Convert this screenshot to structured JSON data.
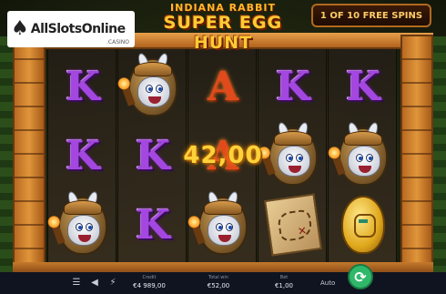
{
  "logo": {
    "brand": "AllSlotsOnline",
    "suffix": ".CASINO"
  },
  "game": {
    "title_top": "INDIANA RABBIT",
    "title_main": "SUPER EGG HUNT"
  },
  "free_spins": {
    "label": "1 OF 10 FREE SPINS",
    "current": 1,
    "total": 10
  },
  "win": {
    "amount": "42,00"
  },
  "reels": [
    [
      "K",
      "K",
      "rabbit"
    ],
    [
      "rabbit",
      "K",
      "K"
    ],
    [
      "A",
      "A",
      "rabbit"
    ],
    [
      "K",
      "rabbit",
      "map"
    ],
    [
      "K",
      "rabbit",
      "golden-egg"
    ]
  ],
  "symbols": {
    "k_letter": "K",
    "a_letter": "A"
  },
  "bottom_bar": {
    "credit_label": "Credit",
    "credit_value": "€4 989,00",
    "total_win_label": "Total win",
    "total_win_value": "€52,00",
    "bet_label": "Bet",
    "bet_value": "€1,00",
    "auto_label": "Auto",
    "menu_icon": "menu-icon",
    "sound_icon": "speaker-icon",
    "turbo_icon": "lightning-icon",
    "spin_icon": "refresh-icon"
  },
  "colors": {
    "k_symbol": "#a447e0",
    "a_symbol": "#e04a1c",
    "win_text": "#ffd23a",
    "spin_button": "#2fb86a",
    "frame_accent": "#b06a1e"
  }
}
